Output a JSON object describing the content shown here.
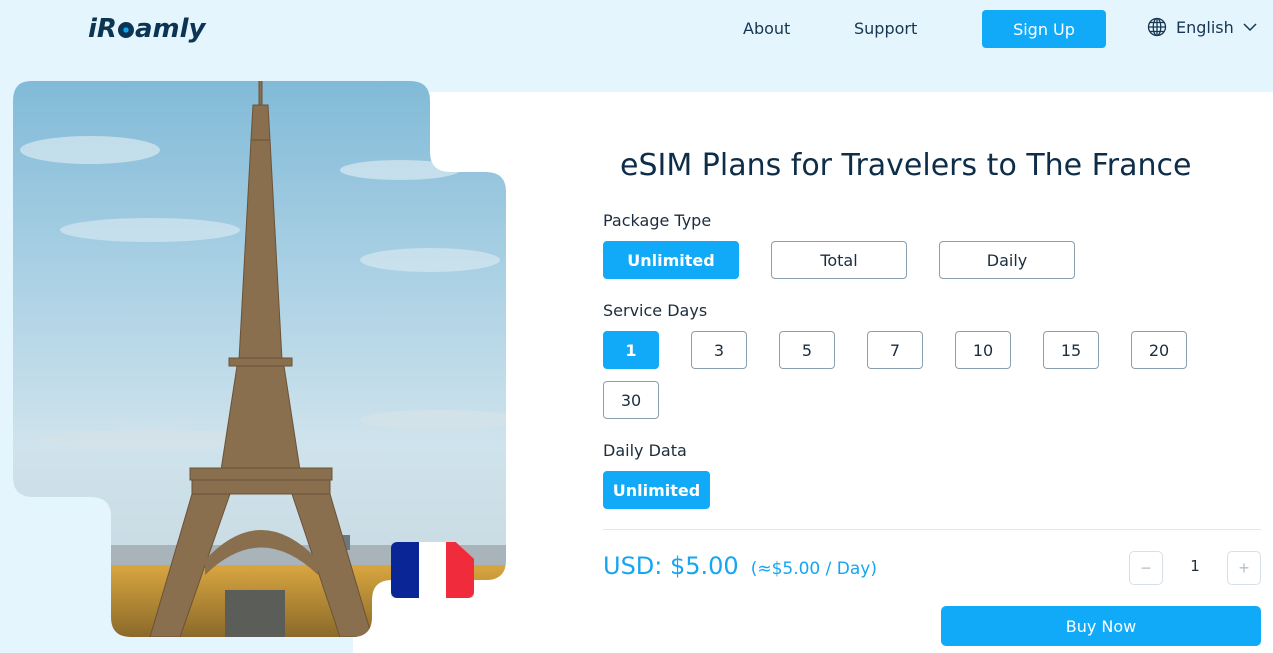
{
  "header": {
    "logo": {
      "prefix": "iR",
      "suffix": "amly"
    },
    "nav": [
      {
        "label": "About"
      },
      {
        "label": "Support"
      }
    ],
    "signup_label": "Sign Up",
    "language": {
      "label": "English",
      "icon": "globe-icon"
    }
  },
  "hero": {
    "image_alt": "Eiffel Tower",
    "flag": {
      "country": "France",
      "colors": [
        "#0a2596",
        "#ffffff",
        "#ef2b3c"
      ]
    }
  },
  "plan": {
    "title": "eSIM Plans for Travelers to The France",
    "package_type": {
      "label": "Package Type",
      "options": [
        {
          "label": "Unlimited",
          "selected": true
        },
        {
          "label": "Total",
          "selected": false
        },
        {
          "label": "Daily",
          "selected": false
        }
      ]
    },
    "service_days": {
      "label": "Service Days",
      "options": [
        {
          "label": "1",
          "selected": true
        },
        {
          "label": "3",
          "selected": false
        },
        {
          "label": "5",
          "selected": false
        },
        {
          "label": "7",
          "selected": false
        },
        {
          "label": "10",
          "selected": false
        },
        {
          "label": "15",
          "selected": false
        },
        {
          "label": "20",
          "selected": false
        },
        {
          "label": "30",
          "selected": false
        }
      ]
    },
    "daily_data": {
      "label": "Daily Data",
      "options": [
        {
          "label": "Unlimited",
          "selected": true
        }
      ]
    },
    "price": {
      "main": "USD: $5.00",
      "per_day": "(≈$5.00 / Day)"
    },
    "quantity": {
      "value": "1",
      "decrement": "−",
      "increment": "+"
    },
    "buy_label": "Buy Now"
  },
  "colors": {
    "accent": "#10aaf9",
    "header_bg": "#e4f5fe",
    "text_dark": "#0e2d48"
  }
}
